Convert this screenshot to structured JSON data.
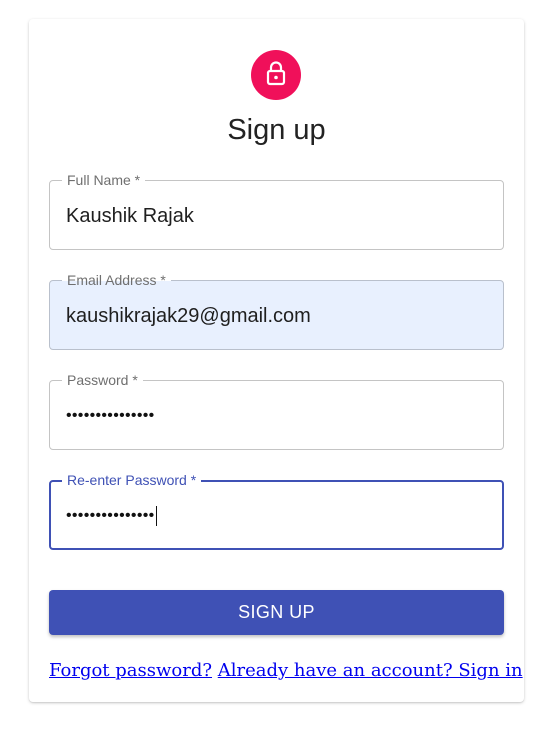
{
  "form": {
    "title": "Sign up",
    "icon": "lock-icon",
    "accent_color": "#f0105a",
    "primary_color": "#3f51b5",
    "fields": [
      {
        "label": "Full Name *",
        "value": "Kaushik Rajak"
      },
      {
        "label": "Email Address *",
        "value": "kaushikrajak29@gmail.com"
      },
      {
        "label": "Password *",
        "value": "•••••••••••••••"
      },
      {
        "label": "Re-enter Password *",
        "value": "•••••••••••••••"
      }
    ],
    "submit_label": "SIGN UP",
    "forgot_password_link": "Forgot password?",
    "sign_in_link": "Already have an account? Sign in"
  }
}
